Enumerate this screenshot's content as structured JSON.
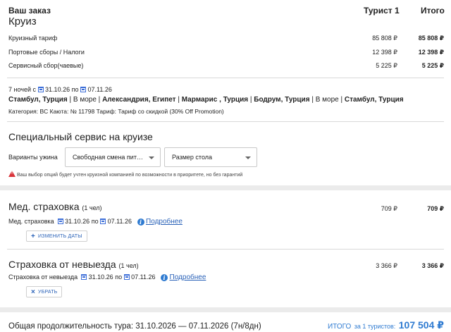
{
  "order": {
    "title": "Ваш заказ",
    "subtitle": "Круиз",
    "col_tourist": "Турист 1",
    "col_total": "Итого",
    "rows": [
      {
        "label": "Круизный тариф",
        "tourist": "85 808 ₽",
        "total": "85 808 ₽"
      },
      {
        "label": "Портовые сборы / Налоги",
        "tourist": "12 398 ₽",
        "total": "12 398 ₽"
      },
      {
        "label": "Сервисный сбор(чаевые)",
        "tourist": "5 225 ₽",
        "total": "5 225 ₽"
      }
    ]
  },
  "cruise": {
    "nights_prefix": "7 ночей с",
    "date_from": "31.10.26",
    "to_word": "по",
    "date_to": "07.11.26",
    "route": [
      {
        "text": "Стамбул, Турция",
        "bold": true
      },
      {
        "text": " | ",
        "bold": false
      },
      {
        "text": "В море",
        "bold": false
      },
      {
        "text": " | ",
        "bold": false
      },
      {
        "text": "Александрия, Египет",
        "bold": true
      },
      {
        "text": " | ",
        "bold": false
      },
      {
        "text": "Мармарис , Турция",
        "bold": true
      },
      {
        "text": " | ",
        "bold": false
      },
      {
        "text": "Бодрум, Турция",
        "bold": true
      },
      {
        "text": " | ",
        "bold": false
      },
      {
        "text": "В море",
        "bold": false
      },
      {
        "text": " | ",
        "bold": false
      },
      {
        "text": "Стамбул, Турция",
        "bold": true
      }
    ],
    "details": "Категория: BC  Каюта: № 11798  Тариф: Тариф со скидкой (30% Off Promotion)"
  },
  "special": {
    "title": "Специальный сервис на круизе",
    "dinner_label": "Варианты ужина",
    "dinner_value": "Свободная смена пит…",
    "table_value": "Размер стола",
    "warning": "Ваш выбор опций будет учтен круизной компанией по возможности в приоритете, но без гарантий"
  },
  "med": {
    "title": "Мед. страховка",
    "count": "(1 чел)",
    "tourist": "709 ₽",
    "total": "709 ₽",
    "label": "Мед. страховка",
    "date_from": "31.10.26",
    "to_word": "по",
    "date_to": "07.11.26",
    "more": "Подробнее",
    "button": "ИЗМЕНИТЬ ДАТЫ",
    "button_icon": "+"
  },
  "cancel": {
    "title": "Страховка от невыезда",
    "count": "(1 чел)",
    "tourist": "3 366 ₽",
    "total": "3 366 ₽",
    "label": "Страховка от невыезда",
    "date_from": "31.10.26",
    "to_word": "по",
    "date_to": "07.11.26",
    "more": "Подробнее",
    "button": "УБРАТЬ",
    "button_icon": "×"
  },
  "footer": {
    "duration": "Общая продолжительность тура: 31.10.2026 — 07.11.2026 (7н/8дн)",
    "total_label": "ИТОГО",
    "total_for": "за 1 туристов:",
    "total_value": "107 504 ₽"
  },
  "colors": {
    "accent": "#2a62b8",
    "warning": "#d9343a",
    "total": "#2f7bd1"
  }
}
